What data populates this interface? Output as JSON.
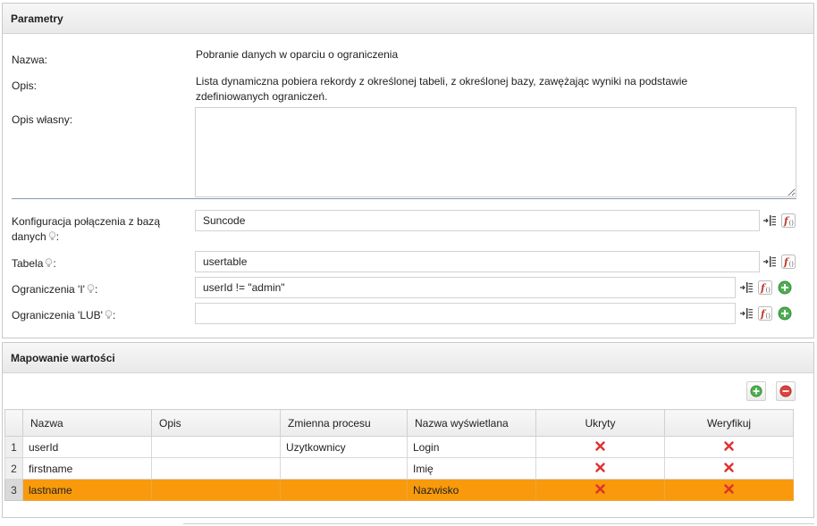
{
  "params": {
    "title": "Parametry",
    "name_label": "Nazwa:",
    "name_value": "Pobranie danych w oparciu o ograniczenia",
    "desc_label": "Opis:",
    "desc_line1": "Lista dynamiczna pobiera rekordy z określonej tabeli, z określonej bazy, zawężając wyniki na podstawie",
    "desc_line2": "zdefiniowanych ograniczeń.",
    "own_desc_label": "Opis własny:",
    "own_desc_value": "",
    "conn_label_line1": "Konfiguracja połączenia z bazą",
    "conn_label_line2": "danych",
    "conn_value": "Suncode",
    "table_label": "Tabela",
    "table_value": "usertable",
    "and_label": "Ograniczenia 'I'",
    "and_value": "userId != \"admin\"",
    "or_label": "Ograniczenia 'LUB'",
    "or_value": ""
  },
  "mapping": {
    "title": "Mapowanie wartości",
    "columns": [
      "Nazwa",
      "Opis",
      "Zmienna procesu",
      "Nazwa wyświetlana",
      "Ukryty",
      "Weryfikuj"
    ],
    "rows": [
      {
        "num": "1",
        "name": "userId",
        "desc": "",
        "var": "Uzytkownicy",
        "display": "Login",
        "hidden": "false",
        "verify": "false"
      },
      {
        "num": "2",
        "name": "firstname",
        "desc": "",
        "var": "",
        "display": "Imię",
        "hidden": "false",
        "verify": "false"
      },
      {
        "num": "3",
        "name": "lastname",
        "desc": "",
        "var": "",
        "display": "Nazwisko",
        "hidden": "false",
        "verify": "false"
      }
    ],
    "selected_row": 3
  },
  "colors": {
    "selected_row": "#f89a0b",
    "add_green": "#5cb85c",
    "remove_red": "#e04040",
    "divider": "#8a9aa8"
  },
  "icons": [
    "list-select-icon",
    "function-editor-icon",
    "add-icon",
    "remove-icon",
    "hint-bulb-icon",
    "cross-icon"
  ]
}
